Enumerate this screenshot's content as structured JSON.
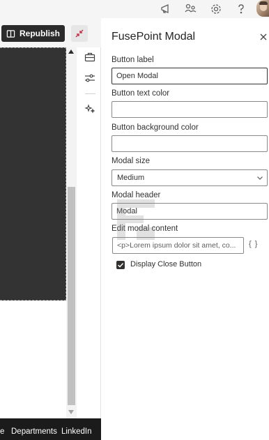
{
  "toolbar": {
    "republish_label": "Republish"
  },
  "footer": {
    "links": [
      "e",
      "Departments",
      "LinkedIn"
    ]
  },
  "panel": {
    "title": "FusePoint Modal",
    "button_label": {
      "label": "Button label",
      "value": "Open Modal"
    },
    "button_text_color": {
      "label": "Button text color",
      "value": ""
    },
    "button_bg_color": {
      "label": "Button background color",
      "value": ""
    },
    "modal_size": {
      "label": "Modal size",
      "value": "Medium"
    },
    "modal_header": {
      "label": "Modal header",
      "value": "Modal"
    },
    "modal_content": {
      "label": "Edit modal content",
      "value": "<p>Lorem ipsum dolor sit amet, co...",
      "braces": "{ }"
    },
    "display_close": {
      "label": "Display Close Button",
      "checked": true
    }
  },
  "icons": {
    "top": [
      "megaphone-icon",
      "org-chart-icon",
      "settings-icon",
      "help-icon",
      "avatar"
    ],
    "rail": [
      "toolbox-icon",
      "sliders-icon",
      "sparkle-icon"
    ]
  },
  "colors": {
    "canvas": "#333333",
    "footer": "#1b1b1b",
    "primary_button": "#2b2b2b"
  }
}
